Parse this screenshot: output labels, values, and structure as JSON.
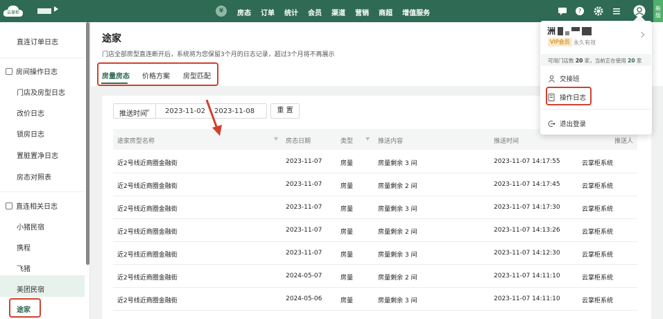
{
  "app": {
    "logo_text": "云掌柜",
    "top_nav": [
      "房态",
      "订单",
      "统计",
      "会员",
      "渠道",
      "营销",
      "商超",
      "增值服务"
    ],
    "yen_symbol": "¥",
    "new_badge": "新版",
    "icons": [
      "message-icon",
      "help-icon",
      "gear-icon",
      "menu-icon",
      "user-icon"
    ]
  },
  "sidebar": {
    "items": [
      {
        "label": "直连订单日志",
        "type": "item"
      },
      {
        "label": "房间操作日志",
        "type": "group"
      },
      {
        "label": "门店及房型日志",
        "type": "item"
      },
      {
        "label": "改价日志",
        "type": "item"
      },
      {
        "label": "锁房日志",
        "type": "item"
      },
      {
        "label": "置脏置净日志",
        "type": "item"
      },
      {
        "label": "房态对照表",
        "type": "item"
      },
      {
        "label": "直连相关日志",
        "type": "group"
      },
      {
        "label": "小猪民宿",
        "type": "item"
      },
      {
        "label": "携程",
        "type": "item"
      },
      {
        "label": "飞猪",
        "type": "item"
      },
      {
        "label": "美团民宿",
        "type": "item"
      },
      {
        "label": "途家",
        "type": "item",
        "active": true
      }
    ]
  },
  "page": {
    "title": "途家",
    "description": "门店全部房型直连断开后，系统将为您保留3个月的日志记录，超过3个月将不再展示",
    "tabs": [
      "房量房态",
      "价格方案",
      "房型匹配"
    ],
    "active_tab": "房量房态"
  },
  "filter": {
    "select_label": "推送时间",
    "date_start": "2023-11-02",
    "date_separator": "-",
    "date_end": "2023-11-08",
    "reset_label": "重 置"
  },
  "table": {
    "columns": [
      "途家房型名称",
      "房态日期",
      "类型",
      "推送内容",
      "推送时间",
      "推送人"
    ],
    "rows": [
      [
        "近2号线近商圈金融街",
        "2023-11-07",
        "房量",
        "房量剩余 3 间",
        "2023-11-07 14:17:55",
        "云掌柜系统"
      ],
      [
        "近2号线近商圈金融街",
        "2023-11-07",
        "房量",
        "房量剩余 2 间",
        "2023-11-07 14:17:45",
        "云掌柜系统"
      ],
      [
        "近2号线近商圈金融街",
        "2023-11-07",
        "房量",
        "房量剩余 3 间",
        "2023-11-07 14:17:30",
        "云掌柜系统"
      ],
      [
        "近2号线近商圈金融街",
        "2023-11-07",
        "房量",
        "房量剩余 2 间",
        "2023-11-07 14:13:26",
        "云掌柜系统"
      ],
      [
        "近2号线近商圈金融街",
        "2023-11-07",
        "房量",
        "房量剩余 3 间",
        "2023-11-07 14:12:30",
        "云掌柜系统"
      ],
      [
        "近2号线近商圈金融街",
        "2024-05-07",
        "房量",
        "房量剩余 2 间",
        "2023-11-07 14:11:10",
        "云掌柜系统"
      ],
      [
        "近2号线近商圈金融街",
        "2024-05-06",
        "房量",
        "房量剩余 3 间",
        "2023-11-07 14:11:10",
        "云掌柜系统"
      ]
    ]
  },
  "user_menu": {
    "name_initial": "洲",
    "vip_label": "VIP会员",
    "vip_validity": "永久有效",
    "quota_prefix": "可用门店数",
    "quota_total": "20",
    "quota_mid": "家，当前正在使用",
    "quota_used": "20",
    "quota_suffix": "家",
    "items": [
      "交接班",
      "操作日志",
      "退出登录"
    ]
  },
  "colors": {
    "brand": "#2f6b54",
    "highlight": "#d0412d"
  }
}
